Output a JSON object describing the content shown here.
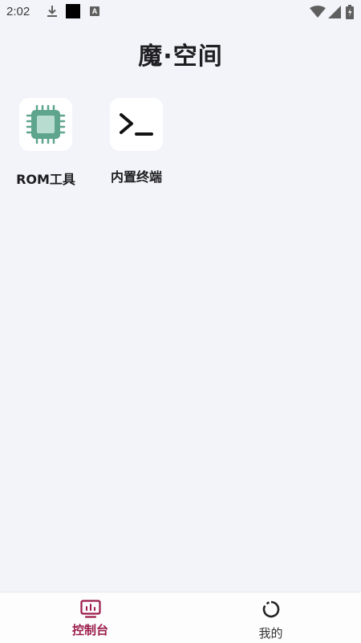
{
  "status_bar": {
    "time": "2:02",
    "a_glyph": "A"
  },
  "page": {
    "title": "魔·空间"
  },
  "tools": [
    {
      "label": "ROM工具",
      "icon": "chip-icon"
    },
    {
      "label": "内置终端",
      "icon": "terminal-icon"
    }
  ],
  "bottom_nav": {
    "items": [
      {
        "label": "控制台",
        "icon": "dashboard-icon",
        "active": true
      },
      {
        "label": "我的",
        "icon": "profile-ring-icon",
        "active": false
      }
    ]
  },
  "colors": {
    "background": "#f3f4f9",
    "accent": "#9b1c4a",
    "chip_green": "#5fa58e",
    "chip_inner": "#b9dcd0"
  }
}
